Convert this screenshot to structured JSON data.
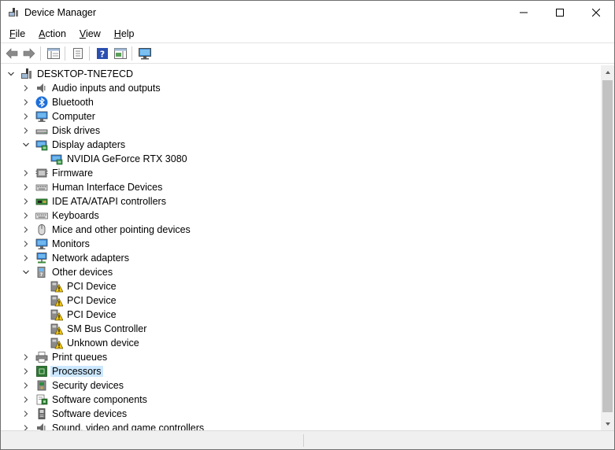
{
  "window": {
    "title": "Device Manager"
  },
  "menu": [
    {
      "key": "F",
      "rest": "ile"
    },
    {
      "key": "A",
      "rest": "ction"
    },
    {
      "key": "V",
      "rest": "iew"
    },
    {
      "key": "H",
      "rest": "elp"
    }
  ],
  "tree": {
    "root": "DESKTOP-TNE7ECD",
    "items": [
      {
        "label": "Audio inputs and outputs",
        "icon": "speaker-icon",
        "expanded": false
      },
      {
        "label": "Bluetooth",
        "icon": "bluetooth-icon",
        "expanded": false
      },
      {
        "label": "Computer",
        "icon": "computer-icon",
        "expanded": false
      },
      {
        "label": "Disk drives",
        "icon": "disk-drive-icon",
        "expanded": false
      },
      {
        "label": "Display adapters",
        "icon": "display-adapter-icon",
        "expanded": true
      },
      {
        "label": "NVIDIA GeForce RTX 3080",
        "icon": "display-adapter-icon",
        "child": true
      },
      {
        "label": "Firmware",
        "icon": "firmware-icon",
        "expanded": false
      },
      {
        "label": "Human Interface Devices",
        "icon": "hid-icon",
        "expanded": false
      },
      {
        "label": "IDE ATA/ATAPI controllers",
        "icon": "ide-controller-icon",
        "expanded": false
      },
      {
        "label": "Keyboards",
        "icon": "keyboard-icon",
        "expanded": false
      },
      {
        "label": "Mice and other pointing devices",
        "icon": "mouse-icon",
        "expanded": false
      },
      {
        "label": "Monitors",
        "icon": "monitor-icon",
        "expanded": false
      },
      {
        "label": "Network adapters",
        "icon": "network-adapter-icon",
        "expanded": false
      },
      {
        "label": "Other devices",
        "icon": "other-devices-icon",
        "expanded": true
      },
      {
        "label": "PCI Device",
        "icon": "warning-device-icon",
        "child": true
      },
      {
        "label": "PCI Device",
        "icon": "warning-device-icon",
        "child": true
      },
      {
        "label": "PCI Device",
        "icon": "warning-device-icon",
        "child": true
      },
      {
        "label": "SM Bus Controller",
        "icon": "warning-device-icon",
        "child": true
      },
      {
        "label": "Unknown device",
        "icon": "warning-device-icon",
        "child": true
      },
      {
        "label": "Print queues",
        "icon": "printer-icon",
        "expanded": false
      },
      {
        "label": "Processors",
        "icon": "processor-icon",
        "expanded": false,
        "selected": true
      },
      {
        "label": "Security devices",
        "icon": "security-device-icon",
        "expanded": false
      },
      {
        "label": "Software components",
        "icon": "software-component-icon",
        "expanded": false
      },
      {
        "label": "Software devices",
        "icon": "software-device-icon",
        "expanded": false
      },
      {
        "label": "Sound, video and game controllers",
        "icon": "sound-controller-icon",
        "expanded": false
      }
    ]
  },
  "colors": {
    "selection": "#cce8ff",
    "accent": "#0078d7"
  }
}
